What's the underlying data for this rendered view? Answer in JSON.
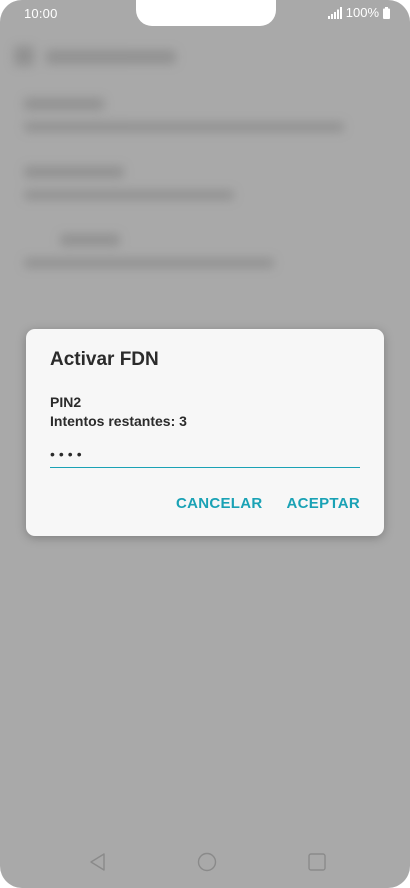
{
  "status_bar": {
    "time": "10:00",
    "battery_text": "100%",
    "icons": [
      "signal-icon",
      "battery-icon"
    ]
  },
  "dialog": {
    "title": "Activar FDN",
    "pin_label": "PIN2",
    "attempts_label": "Intentos restantes: 3",
    "pin_value": "••••",
    "cancel_label": "CANCELAR",
    "accept_label": "ACEPTAR"
  },
  "navigation": {
    "icons": [
      "back-icon",
      "home-icon",
      "recents-icon"
    ]
  },
  "colors": {
    "accent": "#1aa2b5",
    "scrim": "#a9a9a9",
    "dialog_bg": "#f7f7f7",
    "text": "#2b2b2b"
  }
}
